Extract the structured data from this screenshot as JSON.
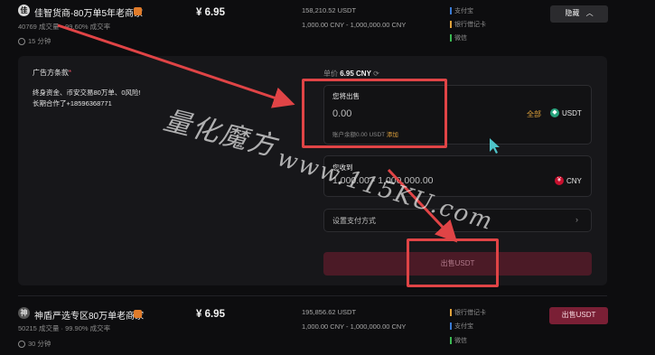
{
  "rows": [
    {
      "avatar": "佳",
      "name": "佳智货商-80万单5年老商家",
      "stats": "40769 成交量 · 99.60% 成交率",
      "time": "15 分钟",
      "price": "¥ 6.95",
      "amount": "158,210.52 USDT",
      "limit": "1,000.00 CNY - 1,000,000.00 CNY",
      "payments": [
        {
          "label": "支付宝",
          "color": "#3a7bd5"
        },
        {
          "label": "银行借记卡",
          "color": "#e0a23b"
        },
        {
          "label": "微信",
          "color": "#3cba54"
        }
      ],
      "button": "隐藏"
    },
    {
      "avatar": "神",
      "name": "神盾严选专区80万单老商家",
      "stats": "50215 成交量 · 99.90% 成交率",
      "time": "30 分钟",
      "price": "¥ 6.95",
      "amount": "195,856.62 USDT",
      "limit": "1,000.00 CNY - 1,000,000.00 CNY",
      "payments": [
        {
          "label": "银行借记卡",
          "color": "#e0a23b"
        },
        {
          "label": "支付宝",
          "color": "#3a7bd5"
        },
        {
          "label": "微信",
          "color": "#3cba54"
        }
      ],
      "button": "出售USDT"
    }
  ],
  "panel": {
    "terms_label": "广告方条款",
    "terms_required": "*",
    "terms_lines": [
      "终身资金、币安交易80万单、0风险!",
      "长期合作了+18596368771"
    ],
    "unit_price_label": "单价",
    "unit_price": "6.95 CNY",
    "sell_label": "您将出售",
    "sell_value": "0.00",
    "all_label": "全部",
    "sell_coin": "USDT",
    "available_text": "账户余额0.00 USDT",
    "add_label": "添加",
    "receive_label": "您收到",
    "receive_value": "1,000.00 - 1,000,000.00",
    "receive_coin": "CNY",
    "set_payment": "设置支付方式",
    "submit": "出售USDT"
  },
  "watermark": {
    "line1": "量化魔方",
    "line2": "www.115KU.com"
  },
  "colors": {
    "accent": "#e0a23b",
    "sell": "#7a1f35",
    "annotation": "#e04446"
  }
}
